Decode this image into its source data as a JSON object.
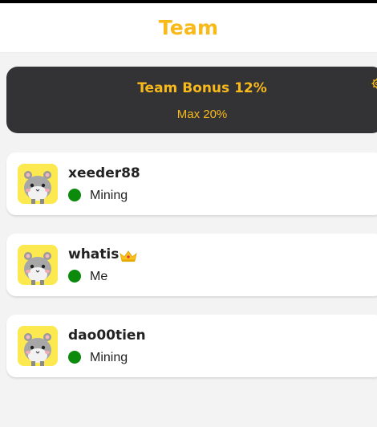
{
  "header": {
    "title": "Team"
  },
  "bonus": {
    "title": "Team Bonus 12%",
    "max": "Max 20%"
  },
  "members": [
    {
      "name": "xeeder88",
      "status": "Mining"
    },
    {
      "name": "whatis",
      "status": "Me"
    },
    {
      "name": "dao00tien",
      "status": "Mining"
    }
  ],
  "colors": {
    "accent": "#f8b91b",
    "dark_card": "#333335",
    "status_green": "#0c8a0c",
    "avatar_bg": "#fce94f"
  }
}
